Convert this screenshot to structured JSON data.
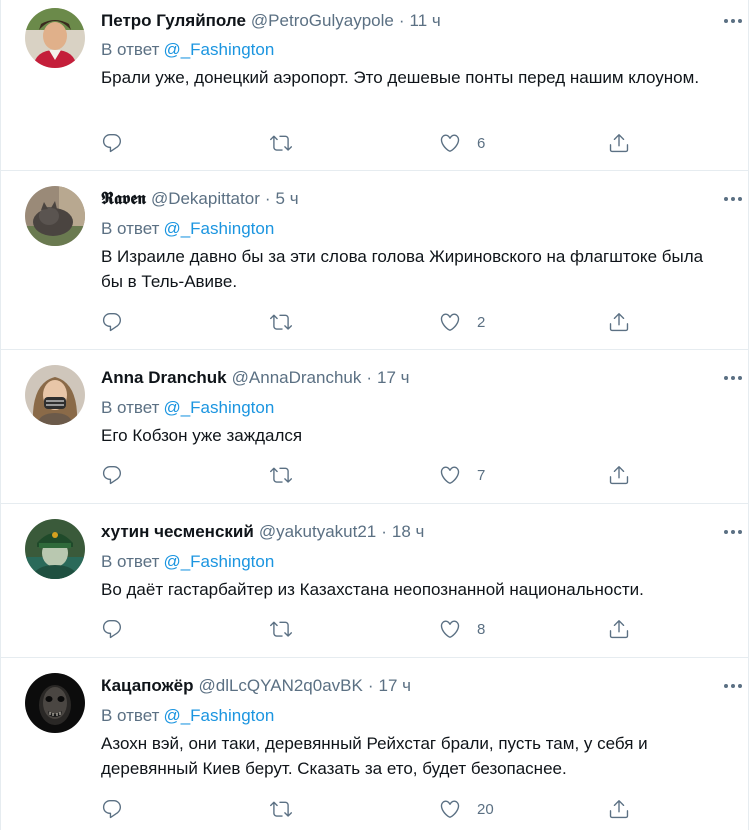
{
  "tweets": [
    {
      "name": "Петро Гуляйполе",
      "handle": "@PetroGulyaypole",
      "dot": "·",
      "time": "11 ч",
      "reply_prefix": "В ответ",
      "reply_mention": "@_Fashington",
      "text": "Брали уже, донецкий аэропорт. Это дешевые понты перед нашим клоуном.",
      "likes": "6"
    },
    {
      "name": "𝕽𝖆𝖛𝖊𝖓",
      "handle": "@Dekapittator",
      "dot": "·",
      "time": "5 ч",
      "reply_prefix": "В ответ",
      "reply_mention": "@_Fashington",
      "text": "В Израиле давно бы за эти слова голова Жириновского на флагштоке была бы в Тель-Авиве.",
      "likes": "2"
    },
    {
      "name": "Anna Dranchuk",
      "handle": "@AnnaDranchuk",
      "dot": "·",
      "time": "17 ч",
      "reply_prefix": "В ответ",
      "reply_mention": "@_Fashington",
      "text": "Его Кобзон уже заждался",
      "likes": "7"
    },
    {
      "name": "хутин чесменский",
      "handle": "@yakutyakut21",
      "dot": "·",
      "time": "18 ч",
      "reply_prefix": "В ответ",
      "reply_mention": "@_Fashington",
      "text": "Во даёт гастарбайтер из Казахстана неопознанной национальности.",
      "likes": "8"
    },
    {
      "name": "Кацапожёр",
      "handle": "@dlLcQYAN2q0avBK",
      "dot": "·",
      "time": "17 ч",
      "reply_prefix": "В ответ",
      "reply_mention": "@_Fashington",
      "text": "Азохн вэй, они таки, деревянный Рейхстаг брали, пусть там, у себя и деревянный Киев берут. Сказать за ето, будет безопаснее.",
      "likes": "20"
    }
  ],
  "colors": {
    "text_primary": "#0f1419",
    "text_secondary": "#5b7083",
    "link": "#1b95e0",
    "divider": "#e6ecf0"
  },
  "icons": [
    "more-icon",
    "reply-icon",
    "retweet-icon",
    "like-icon",
    "share-icon"
  ]
}
